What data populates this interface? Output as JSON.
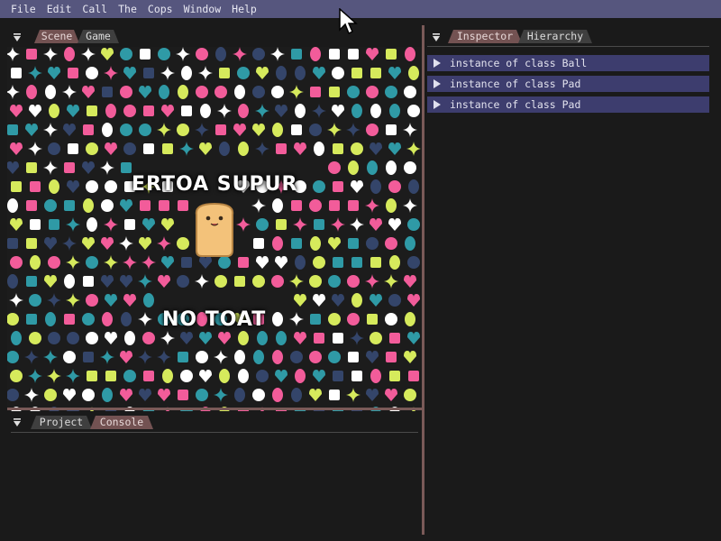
{
  "menubar": {
    "items": [
      "File",
      "Edit",
      "Call",
      "The",
      "Cops",
      "Window",
      "Help"
    ]
  },
  "scene_panel": {
    "tabs": [
      "Scene",
      "Game"
    ],
    "active_tab": "Scene",
    "game_view": {
      "title_top": "ERTOA SUPUR",
      "title_bottom": "NO TOAT",
      "palette": [
        "#f25c9a",
        "#d6ea5c",
        "#ffffff",
        "#2f9aa6",
        "#34456a"
      ]
    }
  },
  "bottom_panel": {
    "tabs": [
      "Project",
      "Console"
    ],
    "active_tab": "Console"
  },
  "inspector_panel": {
    "tabs": [
      "Inspector",
      "Hierarchy"
    ],
    "active_tab": "Inspector",
    "items": [
      {
        "label": "instance of class Ball"
      },
      {
        "label": "instance of class Pad"
      },
      {
        "label": "instance of class Pad"
      }
    ]
  },
  "colors": {
    "menubar_bg": "#56567e",
    "active_tab": "#735252",
    "inactive_tab": "#3f3f3f",
    "row_bg": "#3d3d6e",
    "separator": "#7a5a58",
    "window_bg": "#1a1a1a"
  }
}
